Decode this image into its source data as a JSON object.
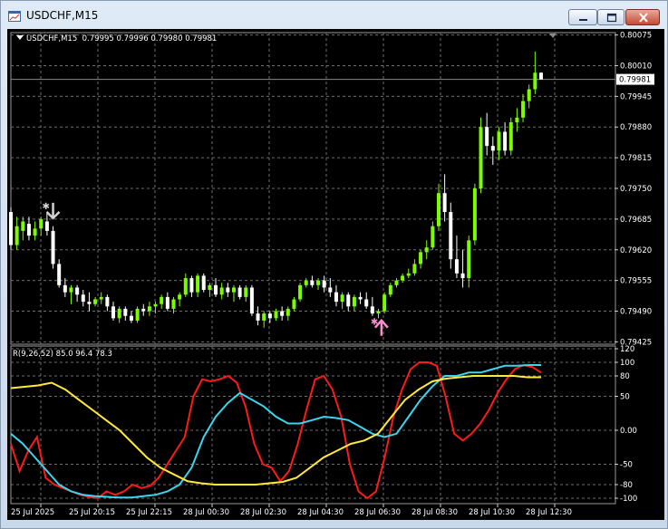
{
  "window": {
    "title": "USDCHF,M15",
    "buttons": [
      "minimize",
      "maximize",
      "close"
    ],
    "icons": [
      "chart-window-icon",
      "minimize-icon",
      "maximize-icon",
      "close-icon"
    ]
  },
  "colors": {
    "background": "#000000",
    "grid": "#6e6e6e",
    "bull_candle": "#7cfc00",
    "bear_candle": "#ffffff",
    "red_line": "#ff1a1a",
    "blue_line": "#3ad6ef",
    "yellow_line": "#ffea3a",
    "sell_arrow": "#d3d3d3",
    "buy_arrow": "#ff8ccf"
  },
  "main_chart": {
    "symbol_label": "USDCHF,M15",
    "ohlc_label": "0.79995 0.79996 0.79980 0.79981",
    "current_price_label": "0.79981",
    "price_axis_labels": [
      "0.80075",
      "0.80010",
      "0.79945",
      "0.79880",
      "0.79815",
      "0.79750",
      "0.79685",
      "0.79620",
      "0.79555",
      "0.79490",
      "0.79425"
    ]
  },
  "indicator": {
    "label": "R(9,26,52) 85.0 96.4 78.3",
    "axis_labels": [
      "120",
      "100",
      "80",
      "50",
      "0.00",
      "-50",
      "-80",
      "-100"
    ]
  },
  "time_axis_labels": [
    "25 Jul 2025",
    "25 Jul 20:15",
    "25 Jul 22:15",
    "28 Jul 00:30",
    "28 Jul 02:30",
    "28 Jul 04:30",
    "28 Jul 06:30",
    "28 Jul 08:30",
    "28 Jul 10:30",
    "28 Jul 12:30"
  ],
  "chart_data": [
    {
      "type": "candlestick",
      "title": "USDCHF,M15",
      "ylim": [
        0.7942,
        0.8008
      ],
      "grid": true,
      "ohlc": [
        [
          0.797,
          0.7971,
          0.7962,
          0.7963
        ],
        [
          0.7963,
          0.7969,
          0.7962,
          0.7967
        ],
        [
          0.7966,
          0.7969,
          0.7964,
          0.7968
        ],
        [
          0.79675,
          0.7969,
          0.7964,
          0.7965
        ],
        [
          0.7965,
          0.7968,
          0.7964,
          0.79665
        ],
        [
          0.79665,
          0.7969,
          0.7965,
          0.79685
        ],
        [
          0.7968,
          0.797,
          0.7965,
          0.7966
        ],
        [
          0.7966,
          0.7967,
          0.7958,
          0.7959
        ],
        [
          0.7959,
          0.796,
          0.7954,
          0.79545
        ],
        [
          0.79545,
          0.7956,
          0.7952,
          0.7953
        ],
        [
          0.7953,
          0.79545,
          0.79505,
          0.7954
        ],
        [
          0.7954,
          0.79545,
          0.7951,
          0.79525
        ],
        [
          0.79525,
          0.79535,
          0.795,
          0.7951
        ],
        [
          0.7951,
          0.7953,
          0.7949,
          0.79505
        ],
        [
          0.79505,
          0.7952,
          0.795,
          0.79515
        ],
        [
          0.79515,
          0.7953,
          0.79505,
          0.7952
        ],
        [
          0.7952,
          0.79525,
          0.7949,
          0.795
        ],
        [
          0.795,
          0.7951,
          0.7947,
          0.79475
        ],
        [
          0.79475,
          0.795,
          0.79465,
          0.79495
        ],
        [
          0.79495,
          0.795,
          0.7947,
          0.7948
        ],
        [
          0.7948,
          0.7949,
          0.79465,
          0.7947
        ],
        [
          0.7947,
          0.795,
          0.79465,
          0.79495
        ],
        [
          0.79495,
          0.79505,
          0.7948,
          0.7949
        ],
        [
          0.7949,
          0.7951,
          0.7948,
          0.795
        ],
        [
          0.795,
          0.7951,
          0.79485,
          0.79505
        ],
        [
          0.79505,
          0.79525,
          0.79495,
          0.7952
        ],
        [
          0.7952,
          0.7953,
          0.7949,
          0.79495
        ],
        [
          0.79495,
          0.7952,
          0.79485,
          0.79515
        ],
        [
          0.79515,
          0.7953,
          0.795,
          0.79525
        ],
        [
          0.79525,
          0.7957,
          0.7952,
          0.7956
        ],
        [
          0.7956,
          0.79565,
          0.7952,
          0.7953
        ],
        [
          0.7953,
          0.7957,
          0.7952,
          0.79565
        ],
        [
          0.79565,
          0.7957,
          0.7953,
          0.79535
        ],
        [
          0.79535,
          0.7955,
          0.7952,
          0.79545
        ],
        [
          0.79545,
          0.7956,
          0.7952,
          0.79525
        ],
        [
          0.79525,
          0.7955,
          0.79515,
          0.7954
        ],
        [
          0.7954,
          0.7955,
          0.7952,
          0.7953
        ],
        [
          0.7953,
          0.79545,
          0.7951,
          0.7954
        ],
        [
          0.7954,
          0.79545,
          0.79515,
          0.7952
        ],
        [
          0.7952,
          0.79545,
          0.7951,
          0.7954
        ],
        [
          0.7954,
          0.79545,
          0.7948,
          0.79485
        ],
        [
          0.79485,
          0.795,
          0.7946,
          0.7947
        ],
        [
          0.7947,
          0.7949,
          0.79455,
          0.79485
        ],
        [
          0.79485,
          0.7949,
          0.79465,
          0.79475
        ],
        [
          0.79475,
          0.79495,
          0.7947,
          0.7949
        ],
        [
          0.7949,
          0.795,
          0.7947,
          0.7948
        ],
        [
          0.7948,
          0.795,
          0.7947,
          0.79495
        ],
        [
          0.79495,
          0.7952,
          0.7949,
          0.79515
        ],
        [
          0.79515,
          0.7955,
          0.7951,
          0.79545
        ],
        [
          0.79545,
          0.7956,
          0.7954,
          0.79555
        ],
        [
          0.79555,
          0.79565,
          0.7954,
          0.79545
        ],
        [
          0.79545,
          0.7956,
          0.79535,
          0.79555
        ],
        [
          0.79555,
          0.79565,
          0.7953,
          0.7954
        ],
        [
          0.7954,
          0.7956,
          0.7952,
          0.7953
        ],
        [
          0.7953,
          0.79545,
          0.795,
          0.7951
        ],
        [
          0.7951,
          0.7953,
          0.79495,
          0.79525
        ],
        [
          0.79525,
          0.7953,
          0.7949,
          0.795
        ],
        [
          0.795,
          0.79525,
          0.7949,
          0.7952
        ],
        [
          0.7952,
          0.7953,
          0.79505,
          0.79515
        ],
        [
          0.79515,
          0.7953,
          0.79495,
          0.795
        ],
        [
          0.795,
          0.7952,
          0.7948,
          0.79485
        ],
        [
          0.79485,
          0.79495,
          0.79475,
          0.7949
        ],
        [
          0.7949,
          0.7953,
          0.79485,
          0.79525
        ],
        [
          0.79525,
          0.7955,
          0.7952,
          0.79545
        ],
        [
          0.79545,
          0.7956,
          0.7954,
          0.79555
        ],
        [
          0.79555,
          0.7957,
          0.7955,
          0.79565
        ],
        [
          0.79565,
          0.7958,
          0.7956,
          0.7957
        ],
        [
          0.7957,
          0.796,
          0.79565,
          0.7959
        ],
        [
          0.7959,
          0.7962,
          0.7958,
          0.79615
        ],
        [
          0.79615,
          0.7964,
          0.796,
          0.79625
        ],
        [
          0.79625,
          0.7968,
          0.7962,
          0.7967
        ],
        [
          0.7967,
          0.7976,
          0.7966,
          0.7974
        ],
        [
          0.7974,
          0.7978,
          0.7968,
          0.797
        ],
        [
          0.797,
          0.7972,
          0.7958,
          0.796
        ],
        [
          0.796,
          0.7965,
          0.7956,
          0.7957
        ],
        [
          0.7957,
          0.7962,
          0.7954,
          0.7956
        ],
        [
          0.7956,
          0.7965,
          0.7954,
          0.7964
        ],
        [
          0.7964,
          0.7976,
          0.7963,
          0.7975
        ],
        [
          0.7975,
          0.799,
          0.7974,
          0.7988
        ],
        [
          0.7988,
          0.7991,
          0.7982,
          0.7984
        ],
        [
          0.7984,
          0.7986,
          0.798,
          0.7983
        ],
        [
          0.7983,
          0.7988,
          0.7981,
          0.7987
        ],
        [
          0.7987,
          0.7989,
          0.7982,
          0.7983
        ],
        [
          0.7983,
          0.799,
          0.7982,
          0.7989
        ],
        [
          0.7989,
          0.7992,
          0.7987,
          0.799
        ],
        [
          0.799,
          0.7995,
          0.7989,
          0.79935
        ],
        [
          0.79935,
          0.7997,
          0.7992,
          0.7996
        ],
        [
          0.7996,
          0.8004,
          0.7995,
          0.79995
        ],
        [
          0.79995,
          0.79996,
          0.7998,
          0.79981
        ]
      ],
      "current_price": 0.79981,
      "signals": [
        {
          "type": "sell",
          "candle_index": 7,
          "price": 0.79685
        },
        {
          "type": "buy",
          "candle_index": 60,
          "price": 0.7948
        }
      ]
    },
    {
      "type": "line",
      "title": "R(9,26,52)",
      "ylim": [
        -108,
        124
      ],
      "ticks": [
        120,
        100,
        80,
        50,
        0,
        -50,
        -80,
        -100
      ],
      "last_values": [
        85.0,
        96.4,
        78.3
      ],
      "grid": true,
      "series": [
        {
          "color": "#ff1a1a",
          "values": [
            -20,
            -60,
            -30,
            -10,
            -70,
            -80,
            -85,
            -90,
            -95,
            -98,
            -100,
            -90,
            -95,
            -90,
            -80,
            -85,
            -82,
            -70,
            -50,
            -30,
            -10,
            50,
            75,
            72,
            75,
            80,
            70,
            35,
            -20,
            -50,
            -55,
            -75,
            -60,
            -20,
            30,
            75,
            80,
            60,
            20,
            -50,
            -90,
            -100,
            -90,
            -40,
            20,
            60,
            90,
            100,
            100,
            95,
            50,
            -5,
            -15,
            -5,
            10,
            30,
            55,
            75,
            90,
            96,
            93,
            85
          ]
        },
        {
          "color": "#3ad6ef",
          "values": [
            -5,
            -20,
            -40,
            -60,
            -80,
            -90,
            -95,
            -97,
            -98,
            -99,
            -99,
            -97,
            -95,
            -90,
            -80,
            -55,
            -10,
            20,
            40,
            55,
            45,
            35,
            20,
            10,
            10,
            15,
            20,
            18,
            15,
            5,
            -5,
            -10,
            -5,
            20,
            45,
            65,
            80,
            80,
            85,
            85,
            90,
            95,
            95,
            96,
            96
          ]
        },
        {
          "color": "#ffea3a",
          "values": [
            62,
            64,
            66,
            70,
            60,
            45,
            30,
            15,
            0,
            -20,
            -40,
            -55,
            -65,
            -75,
            -78,
            -80,
            -80,
            -80,
            -80,
            -78,
            -76,
            -70,
            -55,
            -40,
            -30,
            -20,
            -15,
            -5,
            20,
            45,
            60,
            72,
            76,
            78,
            80,
            80,
            80,
            80,
            78,
            78
          ]
        }
      ]
    }
  ]
}
